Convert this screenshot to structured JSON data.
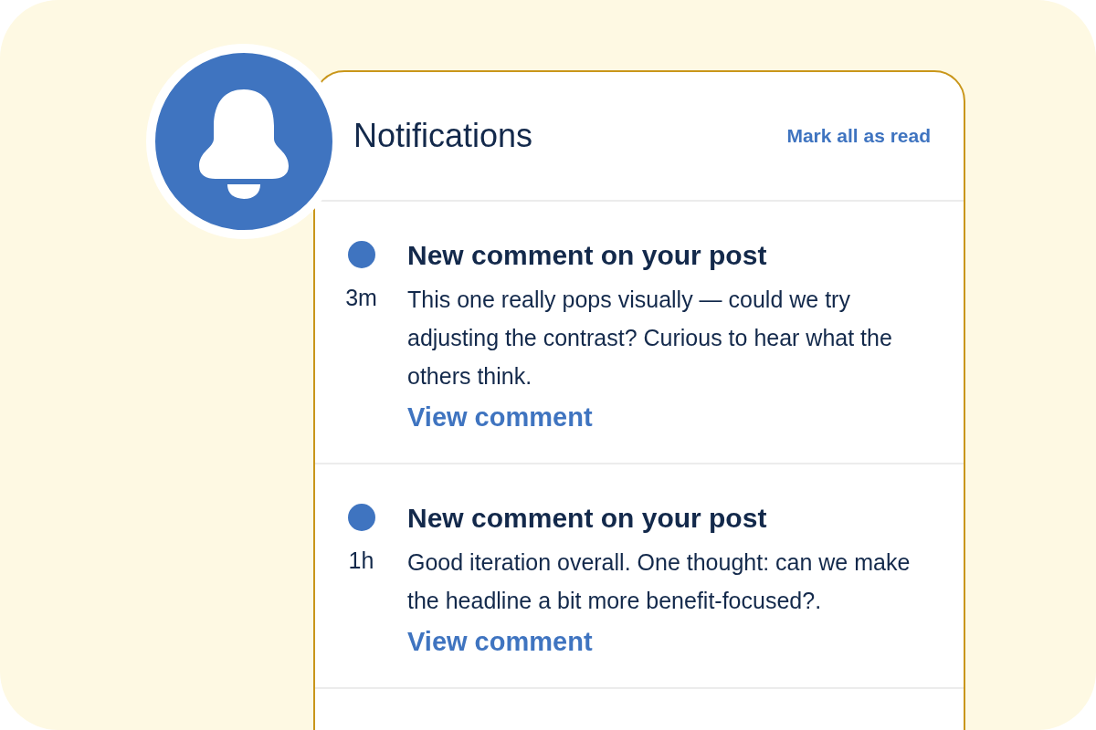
{
  "panel": {
    "title": "Notifications",
    "mark_all_link": "Mark all as read"
  },
  "notifications": [
    {
      "unread": true,
      "time": "3m",
      "title": "New comment on your post",
      "body": "This one really pops visually — could we try adjusting the contrast? Curious to hear what the others think.",
      "link": "View comment"
    },
    {
      "unread": true,
      "time": "1h",
      "title": "New comment on your post",
      "body": "Good iteration overall. One thought: can we make the headline a bit more benefit-focused?.",
      "link": "View comment"
    }
  ]
}
